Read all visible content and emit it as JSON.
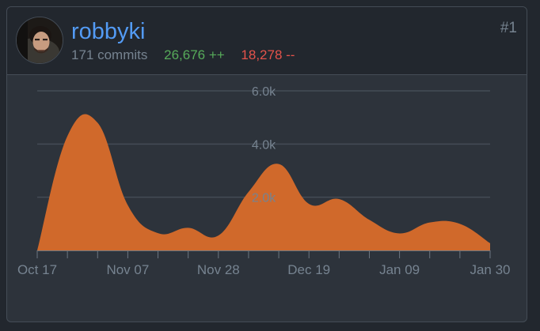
{
  "user": {
    "name": "robbyki",
    "rank": "#1",
    "commits": "171 commits",
    "additions": "26,676 ++",
    "deletions": "18,278 --"
  },
  "colors": {
    "area": "#d0692b",
    "link": "#539bf5",
    "additions": "#57ab5a",
    "deletions": "#e5534b"
  },
  "chart_data": {
    "type": "area",
    "x": [
      "Oct 17",
      "Oct 24",
      "Oct 31",
      "Nov 07",
      "Nov 14",
      "Nov 21",
      "Nov 28",
      "Dec 05",
      "Dec 12",
      "Dec 19",
      "Dec 26",
      "Jan 02",
      "Jan 09",
      "Jan 16",
      "Jan 23",
      "Jan 30"
    ],
    "series": [
      {
        "values": [
          0,
          4300,
          4800,
          1700,
          650,
          850,
          560,
          2200,
          3250,
          1750,
          1930,
          1150,
          640,
          1050,
          1000,
          270
        ]
      }
    ],
    "x_tick_labels": [
      "Oct 17",
      "Nov 07",
      "Nov 28",
      "Dec 19",
      "Jan 09",
      "Jan 30"
    ],
    "y_tick_labels": [
      "2.0k",
      "4.0k",
      "6.0k"
    ],
    "y_ticks": [
      2000,
      4000,
      6000
    ],
    "ylim": [
      0,
      6000
    ],
    "grid": true
  }
}
